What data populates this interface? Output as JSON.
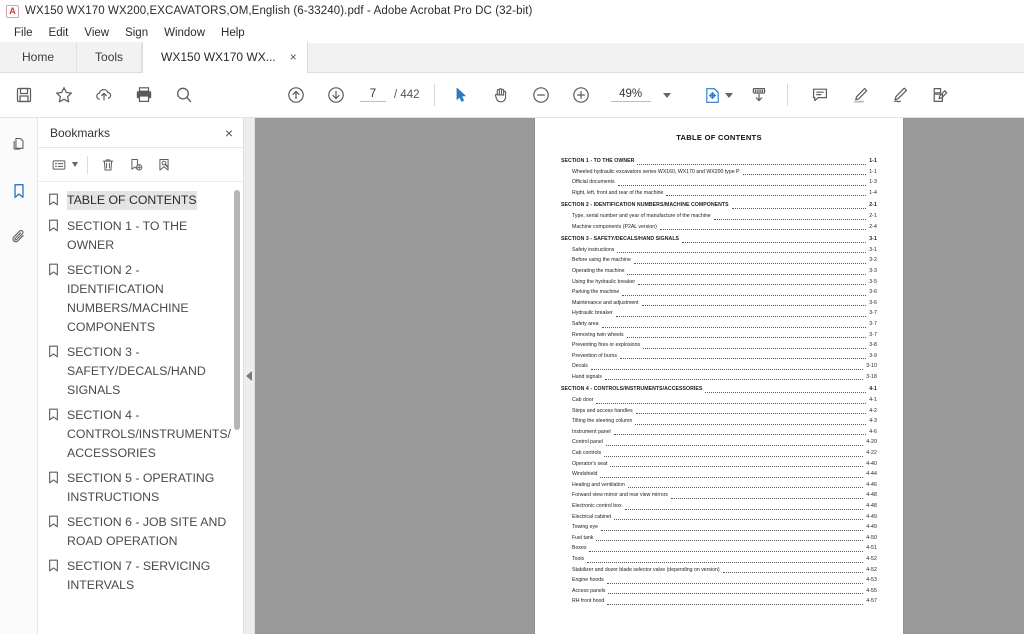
{
  "window": {
    "title": "WX150 WX170 WX200,EXCAVATORS,OM,English (6-33240).pdf - Adobe Acrobat Pro DC (32-bit)",
    "app_icon": "acrobat-logo-icon"
  },
  "menubar": {
    "items": [
      {
        "label": "File"
      },
      {
        "label": "Edit"
      },
      {
        "label": "View"
      },
      {
        "label": "Sign"
      },
      {
        "label": "Window"
      },
      {
        "label": "Help"
      }
    ]
  },
  "tabs": {
    "home_label": "Home",
    "tools_label": "Tools",
    "document_label": "WX150 WX170 WX...",
    "close_glyph": "×"
  },
  "toolbar": {
    "left_icons": [
      {
        "name": "save-icon"
      },
      {
        "name": "star-icon"
      },
      {
        "name": "upload-cloud-icon"
      },
      {
        "name": "print-icon"
      },
      {
        "name": "search-icon"
      }
    ],
    "prev_page_icon": "arrow-up-circle-icon",
    "next_page_icon": "arrow-down-circle-icon",
    "page_number": "7",
    "page_total": "/ 442",
    "select_tool_icon": "cursor-arrow-icon",
    "hand_tool_icon": "hand-icon",
    "zoom_out_icon": "minus-circle-icon",
    "zoom_in_icon": "plus-circle-icon",
    "zoom_value": "49%",
    "zoom_caret_icon": "chevron-down-icon",
    "fit_page_icon": "fit-page-icon",
    "fit_caret_icon": "chevron-down-icon",
    "scroll_mode_icon": "scroll-down-icon",
    "comment_icon": "comment-icon",
    "highlight_icon": "highlight-pen-icon",
    "sign_icon": "sign-pen-icon",
    "stamp_icon": "stamp-edit-icon"
  },
  "rail": {
    "items": [
      {
        "name": "page-thumbnails-icon",
        "active": false
      },
      {
        "name": "bookmarks-icon",
        "active": true
      },
      {
        "name": "attachments-icon",
        "active": false
      }
    ]
  },
  "bookmarks_panel": {
    "title": "Bookmarks",
    "close_glyph": "×",
    "tools": [
      {
        "name": "bookmark-options-icon"
      },
      {
        "name": "delete-bookmark-icon"
      },
      {
        "name": "new-bookmark-icon"
      },
      {
        "name": "find-bookmark-icon"
      }
    ],
    "items": [
      {
        "label": "TABLE OF CONTENTS",
        "selected": true
      },
      {
        "label": "SECTION 1 - TO THE OWNER",
        "selected": false
      },
      {
        "label": "SECTION 2 - IDENTIFICATION NUMBERS/MACHINE COMPONENTS",
        "selected": false
      },
      {
        "label": "SECTION 3 - SAFETY/DECALS/HAND SIGNALS",
        "selected": false
      },
      {
        "label": "SECTION 4 - CONTROLS/INSTRUMENTS/ACCESSORIES",
        "selected": false
      },
      {
        "label": "SECTION 5 - OPERATING INSTRUCTIONS",
        "selected": false
      },
      {
        "label": "SECTION 6 - JOB SITE AND ROAD OPERATION",
        "selected": false
      },
      {
        "label": "SECTION 7 - SERVICING INTERVALS",
        "selected": false
      }
    ]
  },
  "collapse_handle": {
    "name": "collapse-panel-arrow-icon"
  },
  "document": {
    "title": "TABLE OF CONTENTS",
    "entries": [
      {
        "kind": "section",
        "title": "SECTION 1 - TO THE OWNER",
        "page": "1-1"
      },
      {
        "kind": "sub",
        "title": "Wheeled hydraulic excavators series WX160, WX170 and WX200 type P",
        "page": "1-1"
      },
      {
        "kind": "sub",
        "title": "Official documents",
        "page": "1-3"
      },
      {
        "kind": "sub",
        "title": "Right, left, front and rear of the machine",
        "page": "1-4"
      },
      {
        "kind": "section",
        "title": "SECTION 2 - IDENTIFICATION NUMBERS/MACHINE COMPONENTS",
        "page": "2-1"
      },
      {
        "kind": "sub",
        "title": "Type, serial number and year of manufacture of the machine",
        "page": "2-1"
      },
      {
        "kind": "sub",
        "title": "Machine components (P2AL version)",
        "page": "2-4"
      },
      {
        "kind": "section",
        "title": "SECTION 3 - SAFETY/DECALS/HAND SIGNALS",
        "page": "3-1"
      },
      {
        "kind": "sub",
        "title": "Safety instructions",
        "page": "3-1"
      },
      {
        "kind": "sub",
        "title": "Before using the machine",
        "page": "3-2"
      },
      {
        "kind": "sub",
        "title": "Operating the machine",
        "page": "3-3"
      },
      {
        "kind": "sub",
        "title": "Using the hydraulic breaker",
        "page": "3-5"
      },
      {
        "kind": "sub",
        "title": "Parking the machine",
        "page": "3-6"
      },
      {
        "kind": "sub",
        "title": "Maintenance and adjustment",
        "page": "3-6"
      },
      {
        "kind": "sub",
        "title": "Hydraulic breaker",
        "page": "3-7"
      },
      {
        "kind": "sub",
        "title": "Safety area",
        "page": "3-7"
      },
      {
        "kind": "sub",
        "title": "Removing twin wheels",
        "page": "3-7"
      },
      {
        "kind": "sub",
        "title": "Preventing fires or explosions",
        "page": "3-8"
      },
      {
        "kind": "sub",
        "title": "Prevention of burns",
        "page": "3-9"
      },
      {
        "kind": "sub",
        "title": "Decals",
        "page": "3-10"
      },
      {
        "kind": "sub",
        "title": "Hand signals",
        "page": "3-18"
      },
      {
        "kind": "section",
        "title": "SECTION 4 - CONTROLS/INSTRUMENTS/ACCESSORIES",
        "page": "4-1"
      },
      {
        "kind": "sub",
        "title": "Cab door",
        "page": "4-1"
      },
      {
        "kind": "sub",
        "title": "Steps and access handles",
        "page": "4-2"
      },
      {
        "kind": "sub",
        "title": "Tilting the steering column",
        "page": "4-3"
      },
      {
        "kind": "sub",
        "title": "Instrument panel",
        "page": "4-6"
      },
      {
        "kind": "sub",
        "title": "Control panel",
        "page": "4-20"
      },
      {
        "kind": "sub",
        "title": "Cab controls",
        "page": "4-22"
      },
      {
        "kind": "sub",
        "title": "Operator's seat",
        "page": "4-40"
      },
      {
        "kind": "sub",
        "title": "Windshield",
        "page": "4-44"
      },
      {
        "kind": "sub",
        "title": "Heating and ventilation",
        "page": "4-46"
      },
      {
        "kind": "sub",
        "title": "Forward view mirror and rear view mirrors",
        "page": "4-48"
      },
      {
        "kind": "sub",
        "title": "Electronic control box",
        "page": "4-48"
      },
      {
        "kind": "sub",
        "title": "Electrical cabinet",
        "page": "4-49"
      },
      {
        "kind": "sub",
        "title": "Towing eye",
        "page": "4-49"
      },
      {
        "kind": "sub",
        "title": "Fuel tank",
        "page": "4-50"
      },
      {
        "kind": "sub",
        "title": "Boxes",
        "page": "4-51"
      },
      {
        "kind": "sub",
        "title": "Tools",
        "page": "4-52"
      },
      {
        "kind": "sub",
        "title": "Stabilizer and dozer blade selector valve (depending on version)",
        "page": "4-52"
      },
      {
        "kind": "sub",
        "title": "Engine hoods",
        "page": "4-53"
      },
      {
        "kind": "sub",
        "title": "Access panels",
        "page": "4-55"
      },
      {
        "kind": "sub",
        "title": "RH front hood",
        "page": "4-57"
      }
    ]
  },
  "colors": {
    "accent": "#2f79c4",
    "viewer_bg": "#9a9a9a",
    "selection": "#e4e4e4"
  }
}
